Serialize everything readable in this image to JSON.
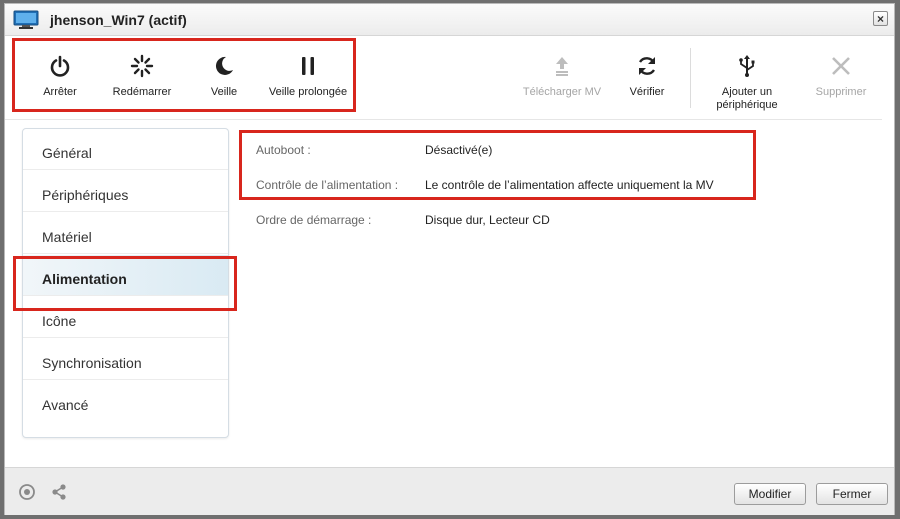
{
  "window": {
    "title": "jhenson_Win7 (actif)",
    "close_label": "×"
  },
  "toolbar": {
    "power": [
      {
        "label": "Arrêter",
        "icon": "power-icon"
      },
      {
        "label": "Redémarrer",
        "icon": "restart-spinner-icon"
      },
      {
        "label": "Veille",
        "icon": "moon-icon"
      },
      {
        "label": "Veille prolongée",
        "icon": "pause-icon"
      }
    ],
    "actions": [
      {
        "label": "Télécharger MV",
        "icon": "upload-icon",
        "enabled": false
      },
      {
        "label": "Vérifier",
        "icon": "refresh-icon",
        "enabled": true
      },
      {
        "label": "Ajouter un périphérique",
        "icon": "usb-icon",
        "enabled": true
      },
      {
        "label": "Supprimer",
        "icon": "delete-x-icon",
        "enabled": false
      }
    ]
  },
  "sidebar": {
    "items": [
      "Général",
      "Périphériques",
      "Matériel",
      "Alimentation",
      "Icône",
      "Synchronisation",
      "Avancé"
    ],
    "active": "Alimentation"
  },
  "details": [
    {
      "key": "Autoboot :",
      "value": "Désactivé(e)"
    },
    {
      "key": "Contrôle de l’alimentation :",
      "value": "Le contrôle de l’alimentation affecte uniquement la MV"
    },
    {
      "key": "Ordre de démarrage :",
      "value": "Disque dur, Lecteur CD"
    }
  ],
  "footer": {
    "modify_label": "Modifier",
    "close_label": "Fermer"
  },
  "colors": {
    "highlight": "#d8261d",
    "active_item": "#d9eaf3"
  }
}
